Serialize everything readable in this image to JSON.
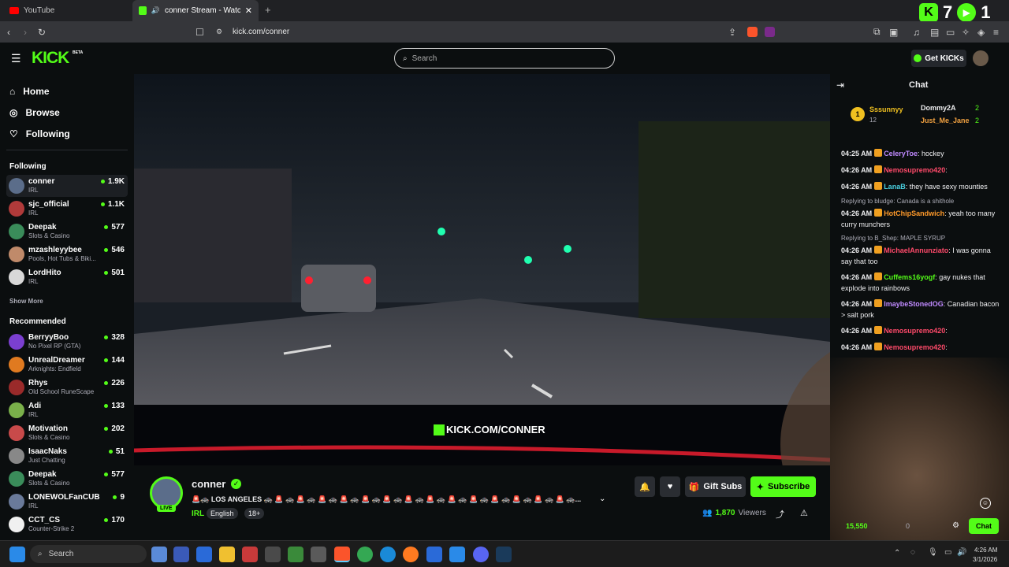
{
  "browser": {
    "tabs": [
      {
        "label": "YouTube"
      },
      {
        "label": "conner Stream - Watch Live o"
      }
    ],
    "new_tab": "+",
    "url": "kick.com/conner",
    "overlay_counts": [
      "7",
      "1"
    ]
  },
  "header": {
    "logo": "KICK",
    "logo_tag": "BETA",
    "search_placeholder": "Search",
    "get_kicks": "Get KICKs"
  },
  "sidebar": {
    "nav": [
      {
        "label": "Home",
        "icon": "home-icon"
      },
      {
        "label": "Browse",
        "icon": "compass-icon"
      },
      {
        "label": "Following",
        "icon": "heart-icon"
      }
    ],
    "following_title": "Following",
    "following": [
      {
        "name": "conner",
        "category": "IRL",
        "viewers": "1.9K",
        "color": "#5b6d8a"
      },
      {
        "name": "sjc_official",
        "category": "IRL",
        "viewers": "1.1K",
        "color": "#b03a3a"
      },
      {
        "name": "Deepak",
        "category": "Slots & Casino",
        "viewers": "577",
        "color": "#3a8c5a"
      },
      {
        "name": "mzashleyybee",
        "category": "Pools, Hot Tubs & Biki...",
        "viewers": "546",
        "color": "#c08a6a"
      },
      {
        "name": "LordHito",
        "category": "IRL",
        "viewers": "501",
        "color": "#d8d8d8"
      }
    ],
    "show_more": "Show More",
    "recommended_title": "Recommended",
    "recommended": [
      {
        "name": "BerryyBoo",
        "category": "No Pixel RP (GTA)",
        "viewers": "328",
        "color": "#7b3fd0"
      },
      {
        "name": "UnrealDreamer",
        "category": "Arknights: Endfield",
        "viewers": "144",
        "color": "#e07a20"
      },
      {
        "name": "Rhys",
        "category": "Old School RuneScape",
        "viewers": "226",
        "color": "#9a2a2a"
      },
      {
        "name": "Adi",
        "category": "IRL",
        "viewers": "133",
        "color": "#7ab04a"
      },
      {
        "name": "Motivation",
        "category": "Slots & Casino",
        "viewers": "202",
        "color": "#c84a4a"
      },
      {
        "name": "IsaacNaks",
        "category": "Just Chatting",
        "viewers": "51",
        "color": "#888888"
      },
      {
        "name": "Deepak",
        "category": "Slots & Casino",
        "viewers": "577",
        "color": "#3a8c5a"
      },
      {
        "name": "LONEWOLFanCUB",
        "category": "IRL",
        "viewers": "9",
        "color": "#6a7a9a"
      },
      {
        "name": "CCT_CS",
        "category": "Counter-Strike 2",
        "viewers": "170",
        "color": "#f0f0f0"
      }
    ]
  },
  "video": {
    "watermark": "KICK.COM/CONNER"
  },
  "stream": {
    "name": "conner",
    "live_label": "LIVE",
    "title": "🚨🚓 LOS ANGELES 🚓 🚨 🚓 🚨 🚓 🚨 🚓 🚨 🚓 🚨 🚓 🚨 🚓 🚨 🚓 🚨 🚓 🚨 🚓 🚨 🚓 🚨 🚓 🚨 🚓 🚨 🚓 🚨 🚓...",
    "category": "IRL",
    "tags": [
      "English",
      "18+"
    ],
    "gift_label": "Gift Subs",
    "subscribe_label": "Subscribe",
    "viewers": "1,870",
    "viewers_label": "Viewers"
  },
  "chat": {
    "title": "Chat",
    "leaderboard": [
      {
        "rank": "1",
        "name": "Sssunnyy",
        "amount": "12"
      },
      {
        "name": "Dommy2A",
        "amount": "2"
      },
      {
        "name": "Just_Me_Jane",
        "amount": "2"
      }
    ],
    "messages": [
      {
        "time": "04:25 AM",
        "user": "CeleryToe",
        "color": "#c08aff",
        "text": ": hockey"
      },
      {
        "time": "04:26 AM",
        "user": "Nemosupremo420",
        "color": "#ff4a6a",
        "text": ":"
      },
      {
        "time": "04:26 AM",
        "user": "LanaB",
        "color": "#4ad0e0",
        "text": ": they have sexy mounties"
      },
      {
        "reply": "Replying to bludge: Canada is a shithole",
        "time": "04:26 AM",
        "user": "HotChipSandwich",
        "color": "#ff9a2a",
        "text": ": yeah too many curry munchers"
      },
      {
        "reply": "Replying to B_Shep: MAPLE SYRUP",
        "time": "04:26 AM",
        "user": "MichaelAnnunziato",
        "color": "#ff4a6a",
        "text": ": I was gonna say that too"
      },
      {
        "time": "04:26 AM",
        "user": "Cuffems16yogf",
        "color": "#53fc18",
        "text": ": gay nukes that explode into rainbows"
      },
      {
        "time": "04:26 AM",
        "user": "ImaybeStonedOG",
        "color": "#c08aff",
        "text": ": Canadian bacon > salt pork"
      },
      {
        "time": "04:26 AM",
        "user": "Nemosupremo420",
        "color": "#ff4a6a",
        "text": ":"
      },
      {
        "time": "04:26 AM",
        "user": "Nemosupremo420",
        "color": "#ff4a6a",
        "text": ":"
      }
    ],
    "kicks_count": "15,550",
    "zero_count": "0",
    "chat_button": "Chat"
  },
  "taskbar": {
    "search_label": "Search",
    "time": "4:26 AM",
    "date": "3/1/2026"
  },
  "colors": {
    "accent": "#53fc18",
    "bg": "#0b0e0f"
  }
}
